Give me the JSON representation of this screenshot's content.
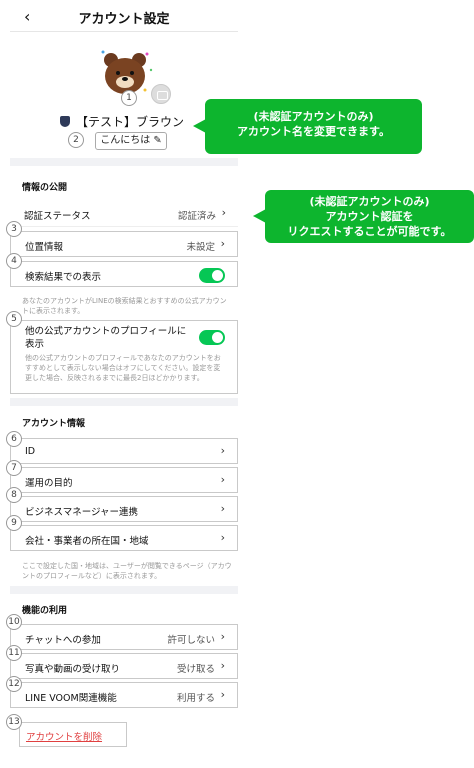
{
  "header": {
    "back_icon": "‹",
    "title": "アカウント設定"
  },
  "profile": {
    "name": "【テスト】ブラウン",
    "status_message": "こんにちは",
    "edit_icon": "✎",
    "camera_icon": "camera-icon",
    "account_icon": "shield-icon"
  },
  "sections": {
    "publicity": {
      "title": "情報の公開",
      "verification": {
        "label": "認証ステータス",
        "value": "認証済み"
      },
      "location": {
        "label": "位置情報",
        "value": "未設定"
      },
      "search": {
        "label": "検索結果での表示",
        "toggle_on": true,
        "note": "あなたのアカウントがLINEの検索結果とおすすめの公式アカウントに表示されます。"
      },
      "other_profiles": {
        "label": "他の公式アカウントのプロフィールに表示",
        "toggle_on": true,
        "note": "他の公式アカウントのプロフィールであなたのアカウントをおすすめとして表示しない場合はオフにしてください。設定を変更した場合、反映されるまでに最長2日ほどかかります。"
      }
    },
    "account_info": {
      "title": "アカウント情報",
      "id": {
        "label": "ID"
      },
      "purpose": {
        "label": "運用の目的"
      },
      "business_manager": {
        "label": "ビジネスマネージャー連携"
      },
      "country": {
        "label": "会社・事業者の所在国・地域"
      },
      "note": "ここで設定した国・地域は、ユーザーが閲覧できるページ（アカウントのプロフィールなど）に表示されます。"
    },
    "features": {
      "title": "機能の利用",
      "chat": {
        "label": "チャットへの参加",
        "value": "許可しない"
      },
      "media": {
        "label": "写真や動画の受け取り",
        "value": "受け取る"
      },
      "voom": {
        "label": "LINE VOOM関連機能",
        "value": "利用する"
      }
    }
  },
  "delete_label": "アカウントを削除",
  "chevron": "›",
  "callouts": {
    "rename": {
      "line1": "(未認証アカウントのみ)",
      "line2": "アカウント名を変更できます。"
    },
    "verify": {
      "line1": "(未認証アカウントのみ)",
      "line2": "アカウント認証を",
      "line3": "リクエストすることが可能です。"
    }
  },
  "badges": [
    "1",
    "2",
    "3",
    "4",
    "5",
    "6",
    "7",
    "8",
    "9",
    "10",
    "11",
    "12",
    "13"
  ],
  "colors": {
    "accent": "#06c755",
    "callout": "#0db52e",
    "danger": "#e04040"
  }
}
